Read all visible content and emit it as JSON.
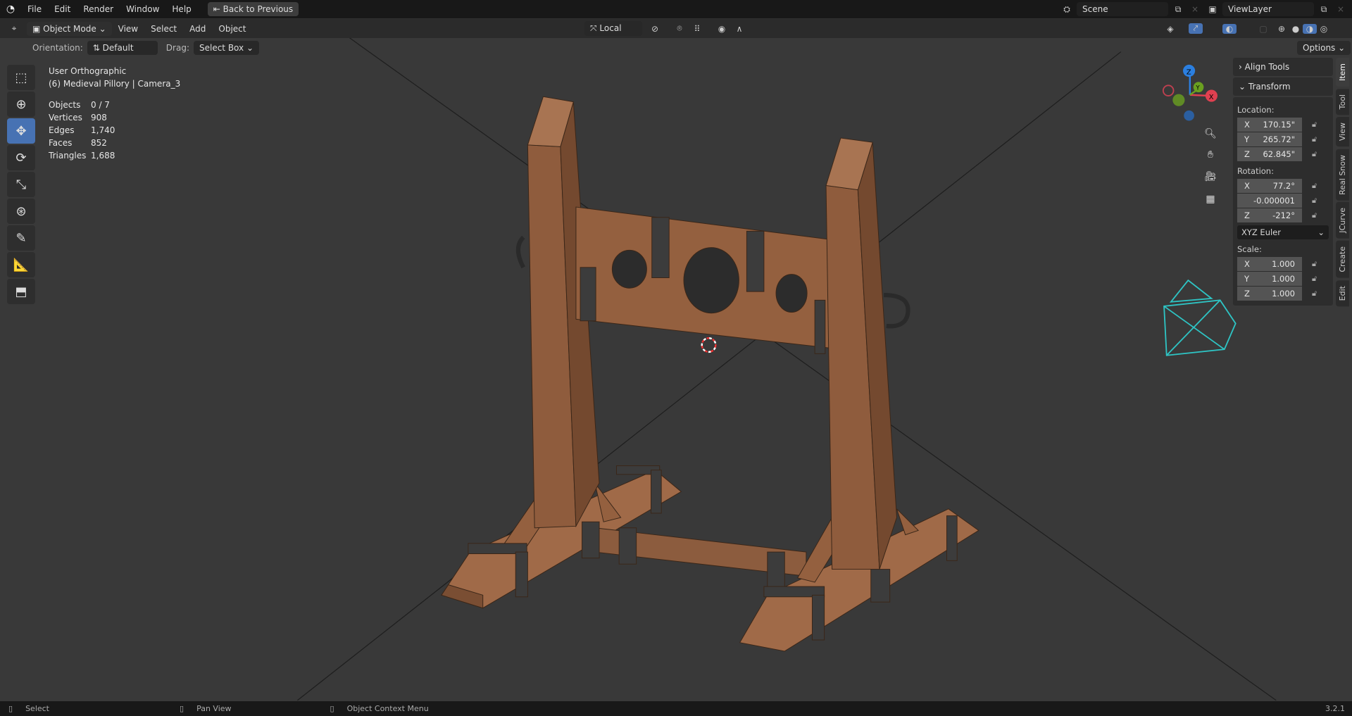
{
  "topbar": {
    "menus": [
      "File",
      "Edit",
      "Render",
      "Window",
      "Help"
    ],
    "back_button": "Back to Previous",
    "scene": "Scene",
    "view_layer": "ViewLayer"
  },
  "header": {
    "mode": "Object Mode",
    "menus": [
      "View",
      "Select",
      "Add",
      "Object"
    ],
    "transform_pivot": "Local",
    "options": "Options"
  },
  "tool_settings": {
    "orientation_label": "Orientation:",
    "orientation_value": "Default",
    "drag_label": "Drag:",
    "drag_value": "Select Box"
  },
  "overlay": {
    "view_name": "User Orthographic",
    "object_info": "(6) Medieval Pillory | Camera_3",
    "stats": [
      {
        "label": "Objects",
        "value": "0 / 7"
      },
      {
        "label": "Vertices",
        "value": "908"
      },
      {
        "label": "Edges",
        "value": "1,740"
      },
      {
        "label": "Faces",
        "value": "852"
      },
      {
        "label": "Triangles",
        "value": "1,688"
      }
    ]
  },
  "npanel": {
    "align_tools": "Align Tools",
    "transform": "Transform",
    "location_label": "Location:",
    "location": [
      {
        "axis": "X",
        "value": "170.15\""
      },
      {
        "axis": "Y",
        "value": "265.72\""
      },
      {
        "axis": "Z",
        "value": "62.845\""
      }
    ],
    "rotation_label": "Rotation:",
    "rotation": [
      {
        "axis": "X",
        "value": "77.2°"
      },
      {
        "axis": "",
        "value": "-0.000001"
      },
      {
        "axis": "Z",
        "value": "-212°"
      }
    ],
    "rotation_mode": "XYZ Euler",
    "scale_label": "Scale:",
    "scale": [
      {
        "axis": "X",
        "value": "1.000"
      },
      {
        "axis": "Y",
        "value": "1.000"
      },
      {
        "axis": "Z",
        "value": "1.000"
      }
    ],
    "tabs": [
      "Item",
      "Tool",
      "View",
      "Real Snow",
      "JCurve",
      "Create",
      "Edit"
    ]
  },
  "gizmo": {
    "x": "X",
    "y": "Y",
    "z": "Z"
  },
  "statusbar": {
    "select": "Select",
    "pan": "Pan View",
    "context": "Object Context Menu",
    "version": "3.2.1"
  },
  "colors": {
    "accent": "#4772b3",
    "camera": "#2ec4c4",
    "wood": "#8a5a3c"
  }
}
